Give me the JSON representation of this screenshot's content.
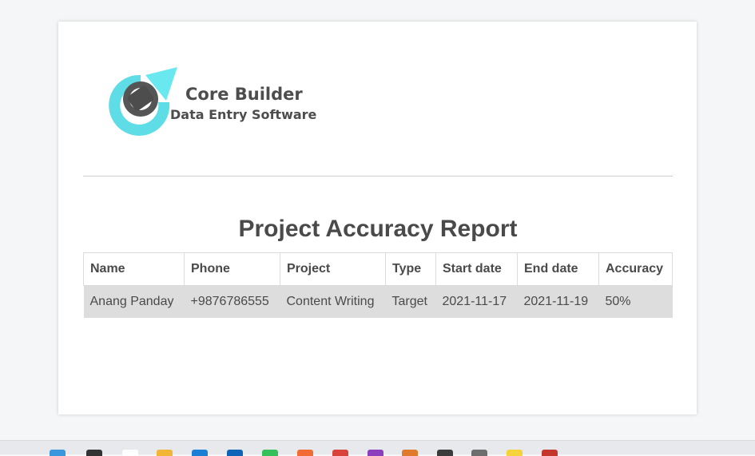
{
  "brand": {
    "name": "Core Builder",
    "tagline": "Data Entry Software",
    "colors": {
      "accent": "#5fdde6",
      "dark": "#4d4d4d"
    }
  },
  "report": {
    "title": "Project Accuracy Report",
    "columns": [
      "Name",
      "Phone",
      "Project",
      "Type",
      "Start date",
      "End date",
      "Accuracy"
    ],
    "rows": [
      [
        "Anang Panday",
        "+9876786555",
        "Content Writing",
        "Target",
        "2021-11-17",
        "2021-11-19",
        "50%"
      ]
    ]
  },
  "taskbar": {
    "icons": [
      {
        "name": "windows-start-icon",
        "color": "#3a96dd"
      },
      {
        "name": "search-icon",
        "color": "#333333"
      },
      {
        "name": "task-view-icon",
        "color": "#ffffff"
      },
      {
        "name": "file-explorer-icon",
        "color": "#f2b636"
      },
      {
        "name": "store-icon",
        "color": "#1c7fd6"
      },
      {
        "name": "mail-icon",
        "color": "#0f64b8"
      },
      {
        "name": "whatsapp-icon",
        "color": "#35c15a"
      },
      {
        "name": "firefox-icon",
        "color": "#f26a34"
      },
      {
        "name": "chrome-icon",
        "color": "#d9423a"
      },
      {
        "name": "app-purple-icon",
        "color": "#8b3fbf"
      },
      {
        "name": "app-orange-icon",
        "color": "#e07a2c"
      },
      {
        "name": "terminal-icon",
        "color": "#3c3c3c"
      },
      {
        "name": "app-gray-icon",
        "color": "#6d6d6d"
      },
      {
        "name": "app-yellow-icon",
        "color": "#f5d33b"
      },
      {
        "name": "active-app-icon",
        "color": "#c5372c"
      }
    ]
  }
}
